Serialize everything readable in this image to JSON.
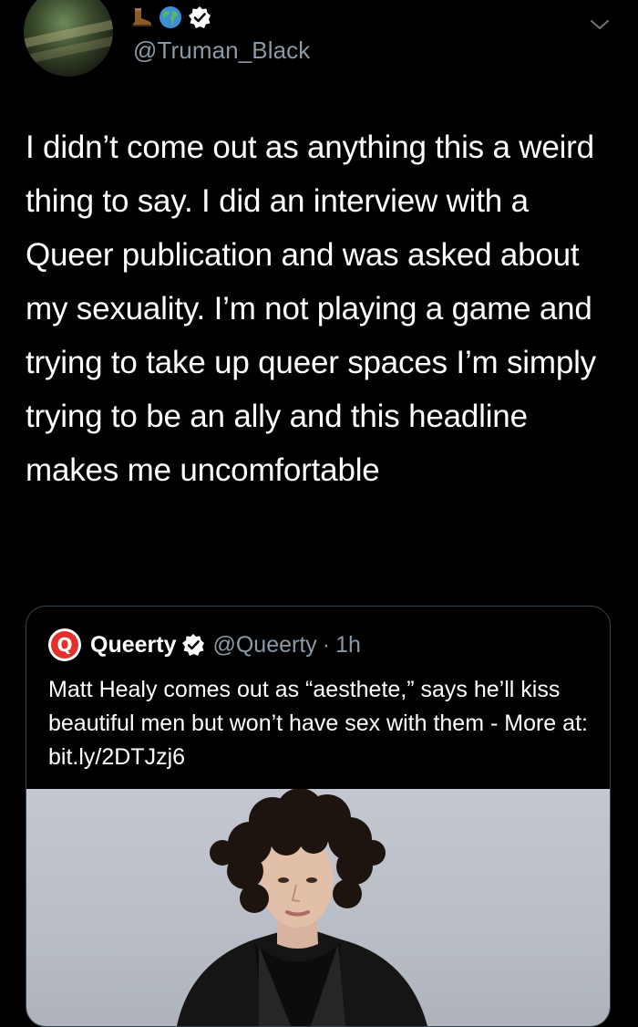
{
  "tweet": {
    "handle": "@Truman_Black",
    "name_emojis": [
      "boot-icon",
      "globe-icon"
    ],
    "text": "I didn’t come out as anything this a weird thing to say. I did an interview with a Queer publication and was asked about my sexuality. I’m not playing a game and trying to take up queer spaces I’m simply trying to be an ally and this headline makes me uncomfortable"
  },
  "quoted_tweet": {
    "logo_letter": "Q",
    "name": "Queerty",
    "handle": "@Queerty",
    "separator": "·",
    "time": "1h",
    "text": "Matt Healy comes out as “aesthete,” says he’ll kiss beautiful men but won’t have sex with them - More at: bit.ly/2DTJzj6"
  },
  "colors": {
    "background": "#000000",
    "text": "#ffffff",
    "secondary_text": "#8b98a5",
    "verified": "#ffffff",
    "card_border": "#38444d",
    "queerty_red": "#e4312b"
  }
}
